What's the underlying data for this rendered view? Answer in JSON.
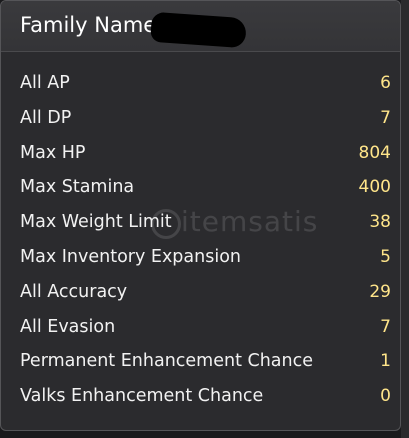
{
  "header": {
    "title": "Family Name"
  },
  "stats": [
    {
      "label": "All AP",
      "value": "6"
    },
    {
      "label": "All DP",
      "value": "7"
    },
    {
      "label": "Max HP",
      "value": "804"
    },
    {
      "label": "Max Stamina",
      "value": "400"
    },
    {
      "label": "Max Weight Limit",
      "value": "38"
    },
    {
      "label": "Max Inventory Expansion",
      "value": "5"
    },
    {
      "label": "All Accuracy",
      "value": "29"
    },
    {
      "label": "All Evasion",
      "value": "7"
    },
    {
      "label": "Permanent Enhancement Chance",
      "value": "1"
    },
    {
      "label": "Valks Enhancement Chance",
      "value": "0"
    }
  ],
  "watermark": {
    "text": "itemsatis"
  },
  "colors": {
    "background": "#2b2b2e",
    "label": "#f2f2f2",
    "value": "#ffe58a"
  }
}
